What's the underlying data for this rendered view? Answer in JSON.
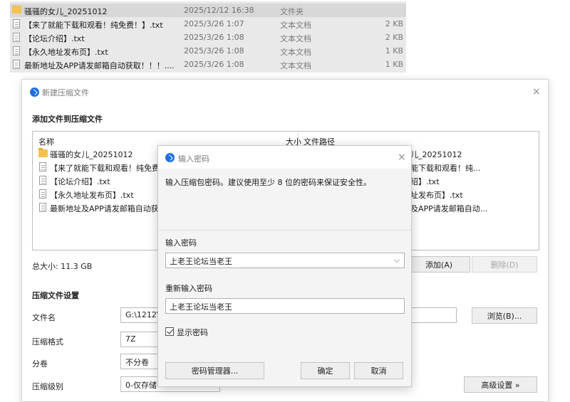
{
  "explorer": {
    "rows": [
      {
        "name": "骚骚的女儿_20251012",
        "date": "2025/12/12 16:38",
        "type": "文件夹",
        "size": "",
        "kind": "folder"
      },
      {
        "name": "【来了就能下载和观看！纯免费！】.txt",
        "date": "2025/3/26 1:07",
        "type": "文本文档",
        "size": "2 KB",
        "kind": "file"
      },
      {
        "name": "【论坛介绍】.txt",
        "date": "2025/3/26 1:08",
        "type": "文本文档",
        "size": "2 KB",
        "kind": "file"
      },
      {
        "name": "【永久地址发布页】.txt",
        "date": "2025/3/26 1:08",
        "type": "文本文档",
        "size": "1 KB",
        "kind": "file"
      },
      {
        "name": "最新地址及APP请发邮箱自动获取！！！....",
        "date": "2025/3/26 1:08",
        "type": "文本文档",
        "size": "1 KB",
        "kind": "file"
      }
    ]
  },
  "main": {
    "title": "新建压缩文件",
    "close": "×",
    "section_add": "添加文件到压缩文件",
    "list_headers": {
      "name": "名称",
      "size": "大小",
      "path": "文件路径"
    },
    "list_rows": [
      {
        "name": "骚骚的女儿_20251012",
        "path": "儿_20251012",
        "kind": "folder"
      },
      {
        "name": "【来了就能下载和观看！纯免费",
        "path": "能下载和观看！纯...",
        "kind": "file"
      },
      {
        "name": "【论坛介绍】.txt",
        "path": "绍】.txt",
        "kind": "file"
      },
      {
        "name": "【永久地址发布页】.txt",
        "path": "址发布页】.txt",
        "kind": "file"
      },
      {
        "name": "最新地址及APP请发邮箱自动获",
        "path": "及APP请发邮箱自动...",
        "kind": "file"
      }
    ],
    "total_size": "总大小: 11.3 GB",
    "add_button": "添加(A)",
    "delete_button": "删除(D)",
    "section_settings": "压缩文件设置",
    "filename_label": "文件名",
    "filename_value": "G:\\1212\\",
    "browse_button": "浏览(B)...",
    "format_label": "压缩格式",
    "format_value": "7Z",
    "split_label": "分卷",
    "split_value": "不分卷",
    "level_label": "压缩级别",
    "level_value": "0-仅存储",
    "advanced_button": "高级设置 »"
  },
  "dialog": {
    "title": "输入密码",
    "close": "×",
    "hint": "输入压缩包密码。建议使用至少 8 位的密码来保证安全性。",
    "password_label": "输入密码",
    "password_value": "上老王论坛当老王",
    "dropdown_arrow": "⌵",
    "confirm_label": "重新输入密码",
    "confirm_value": "上老王论坛当老王",
    "show_password": "显示密码",
    "show_password_checked": true,
    "manager_button": "密码管理器...",
    "ok_button": "确定",
    "cancel_button": "取消"
  }
}
